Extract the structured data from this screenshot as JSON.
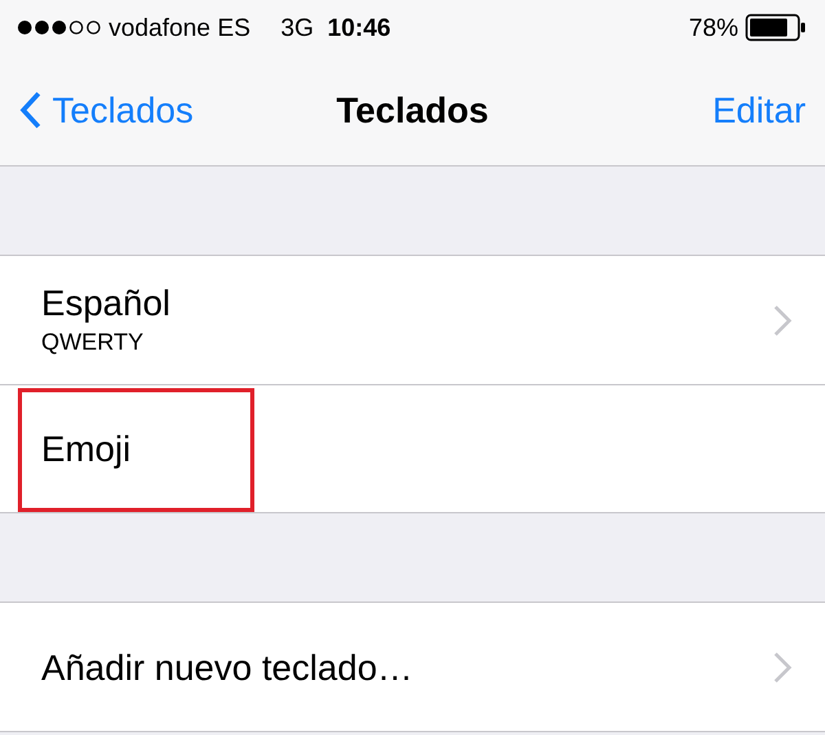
{
  "status_bar": {
    "carrier": "vodafone ES",
    "network": "3G",
    "time": "10:46",
    "battery": "78%"
  },
  "nav": {
    "back": "Teclados",
    "title": "Teclados",
    "action": "Editar"
  },
  "sections": [
    {
      "rows": [
        {
          "title": "Español",
          "subtitle": "QWERTY",
          "chevron": true,
          "highlighted": false
        },
        {
          "title": "Emoji",
          "chevron": false,
          "highlighted": true
        }
      ]
    },
    {
      "rows": [
        {
          "title": "Añadir nuevo teclado…",
          "chevron": true,
          "highlighted": false
        }
      ]
    }
  ]
}
